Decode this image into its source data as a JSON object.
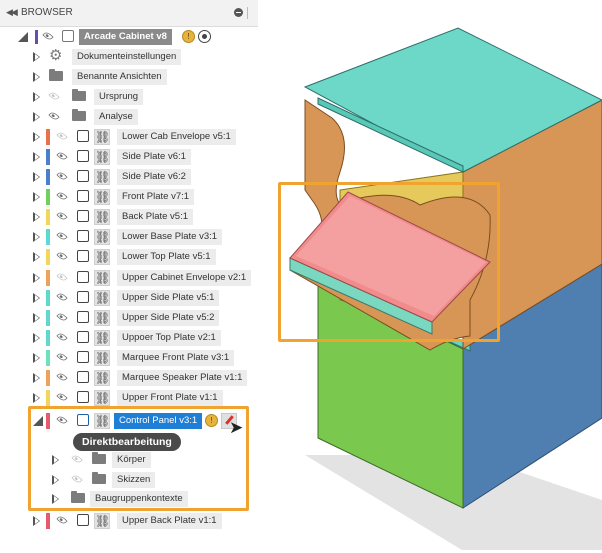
{
  "browser": {
    "title": "BROWSER",
    "root": {
      "label": "Arcade Cabinet v8"
    },
    "items": [
      {
        "label": "Dokumenteinstellungen",
        "kind": "settings",
        "expand": "hollow"
      },
      {
        "label": "Benannte Ansichten",
        "kind": "folder",
        "expand": "hollow"
      },
      {
        "label": "Ursprung",
        "kind": "folder",
        "eye": "off",
        "expand": "hollow"
      },
      {
        "label": "Analyse",
        "kind": "folder",
        "eye": "on",
        "expand": "hollow"
      },
      {
        "label": "Lower Cab Envelope v5:1",
        "color": "#e8734a",
        "eye": "off",
        "expand": "hollow"
      },
      {
        "label": "Side Plate v6:1",
        "color": "#4d7fc9",
        "eye": "on",
        "expand": "hollow"
      },
      {
        "label": "Side Plate v6:2",
        "color": "#4d7fc9",
        "eye": "on",
        "expand": "hollow"
      },
      {
        "label": "Front Plate v7:1",
        "color": "#6fd15a",
        "eye": "on",
        "expand": "hollow"
      },
      {
        "label": "Back Plate v5:1",
        "color": "#f0d65a",
        "eye": "on",
        "expand": "hollow"
      },
      {
        "label": "Lower Base Plate v3:1",
        "color": "#5fd8d0",
        "eye": "on",
        "expand": "hollow"
      },
      {
        "label": "Lower Top Plate v5:1",
        "color": "#f0d65a",
        "eye": "on",
        "expand": "hollow"
      },
      {
        "label": "Upper Cabinet Envelope v2:1",
        "color": "#f0a25a",
        "eye": "off",
        "expand": "hollow"
      },
      {
        "label": "Upper Side Plate v5:1",
        "color": "#5fd8d0",
        "eye": "on",
        "expand": "hollow"
      },
      {
        "label": "Upper Side Plate v5:2",
        "color": "#5fd8d0",
        "eye": "on",
        "expand": "hollow"
      },
      {
        "label": "Uppoer Top Plate v2:1",
        "color": "#5fd8d0",
        "eye": "on",
        "expand": "hollow"
      },
      {
        "label": "Marquee Front Plate v3:1",
        "color": "#6fe0b8",
        "eye": "on",
        "expand": "hollow"
      },
      {
        "label": "Marquee Speaker Plate v1:1",
        "color": "#f0a25a",
        "eye": "on",
        "expand": "hollow"
      },
      {
        "label": "Upper Front Plate v1:1",
        "color": "#f0d65a",
        "eye": "on",
        "expand": "hollow"
      }
    ],
    "selected": {
      "label": "Control Panel v3:1",
      "color": "#e85a6a"
    },
    "tooltip": "Direktbearbeitung",
    "children": [
      {
        "label": "Körper",
        "eye": "off"
      },
      {
        "label": "Skizzen",
        "eye": "off"
      },
      {
        "label": "Baugruppenkontexte"
      }
    ],
    "last": {
      "label": "Upper Back Plate v1:1",
      "color": "#e85a6a"
    }
  },
  "colors": {
    "highlight": "#f0a32f",
    "selection": "#1f7fd6",
    "cab_top": "#6ed8c8",
    "cab_side": "#d89656",
    "cab_front": "#7ac94e",
    "cab_right": "#4e7fb0",
    "panel_top": "#f28c8c"
  }
}
